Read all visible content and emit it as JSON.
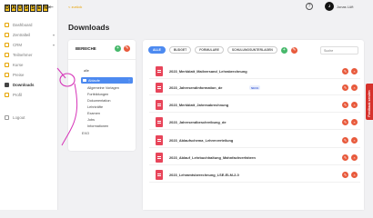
{
  "logo": {
    "letters": [
      "D",
      "A",
      "U",
      "S",
      "S",
      "E",
      "N"
    ]
  },
  "nav": {
    "collapse_icon": "collapse-icon",
    "items": [
      {
        "label": "Dashboard"
      },
      {
        "label": "Zentralteil"
      },
      {
        "label": "CRM"
      },
      {
        "label": "Teilnehmer"
      },
      {
        "label": "Kurse"
      },
      {
        "label": "Preise"
      },
      {
        "label": "Downloads"
      },
      {
        "label": "Profil"
      },
      {
        "label": "Logout"
      }
    ]
  },
  "header": {
    "breadcrumb": "< zurück",
    "title": "Downloads",
    "help_icon": "?",
    "avatar_initials": "J",
    "user_name": "Jonas Lüft"
  },
  "bereiche": {
    "title": "BEREICHE",
    "add_icon": "+",
    "edit_icon": "✎",
    "tree": {
      "root": "alle",
      "selected": "Ablaufe",
      "children": [
        "Allgemeine Vorlagen",
        "Fortbildungen",
        "Dokumentation",
        "Lehrkräfte",
        "Examen",
        "Jobs",
        "Informationen"
      ],
      "last": "EXO"
    }
  },
  "filters": {
    "items": [
      "ALLE",
      "BUDGET",
      "FORMULARE",
      "SCHULUNGSUNTERLAGEN"
    ],
    "active_index": 0,
    "add_icon": "+",
    "edit_icon": "✎"
  },
  "search": {
    "placeholder": "Suche"
  },
  "files": [
    {
      "name": "2023_Merkblatt_Mailversand_Lehrabrechnung",
      "badge": ""
    },
    {
      "name": "2023_Jahresendinformation_de",
      "badge": "NEUE"
    },
    {
      "name": "2023_Merkblatt_Jahresabrechnung",
      "badge": ""
    },
    {
      "name": "2023_Jahresendbeschreibung_de",
      "badge": ""
    },
    {
      "name": "2023_Ablaufschema_Lehrerverteilung",
      "badge": ""
    },
    {
      "name": "2023_Ablauf_Lehrbuchhaltung_Mahnfachverfahren",
      "badge": ""
    },
    {
      "name": "2023_Lehramtsberechnung_LSE-ELM-2-0",
      "badge": ""
    }
  ],
  "row_actions": {
    "edit_icon": "✎",
    "delete_icon": "🗑"
  },
  "feedback": {
    "label": "Feedback senden"
  },
  "colors": {
    "accent_yellow": "#f6c21b",
    "accent_blue": "#4d8af0",
    "action_red": "#e85a3c",
    "pdf_red": "#e8455a",
    "annotation_magenta": "#d633b8",
    "feedback_red": "#d6322c"
  }
}
